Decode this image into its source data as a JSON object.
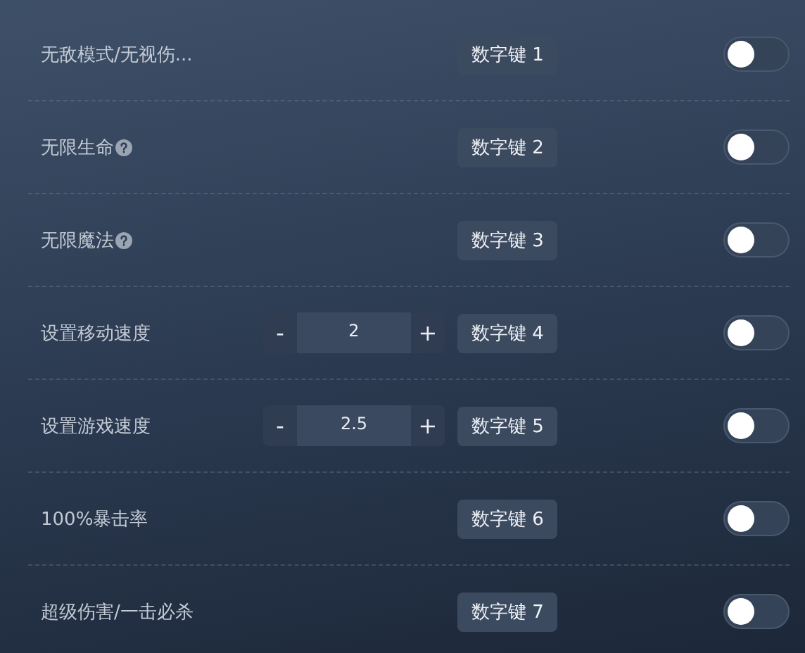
{
  "rows": [
    {
      "kind": "plain",
      "label": "无敌模式/无视伤...",
      "help": false,
      "hotkey": "数字键 1",
      "on": false
    },
    {
      "kind": "plain",
      "label": "无限生命",
      "help": true,
      "hotkey": "数字键 2",
      "on": false
    },
    {
      "kind": "plain",
      "label": "无限魔法",
      "help": true,
      "hotkey": "数字键 3",
      "on": false
    },
    {
      "kind": "stepper",
      "label": "设置移动速度",
      "help": false,
      "minus": "-",
      "value": "2",
      "plus": "+",
      "hotkey": "数字键 4",
      "on": false
    },
    {
      "kind": "stepper",
      "label": "设置游戏速度",
      "help": false,
      "minus": "-",
      "value": "2.5",
      "plus": "+",
      "hotkey": "数字键 5",
      "on": false
    },
    {
      "kind": "plain",
      "label": "100%暴击率",
      "help": false,
      "hotkey": "数字键 6",
      "on": false
    },
    {
      "kind": "plain",
      "label": "超级伤害/一击必杀",
      "help": false,
      "hotkey": "数字键 7",
      "on": false
    }
  ]
}
